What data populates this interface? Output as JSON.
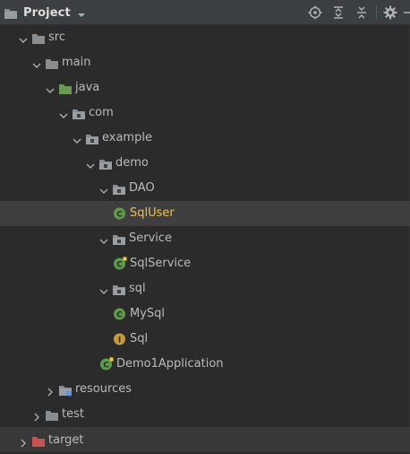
{
  "header": {
    "title": "Project",
    "toolbar": [
      {
        "name": "locate-icon"
      },
      {
        "name": "expand-all-icon"
      },
      {
        "name": "collapse-all-icon"
      },
      {
        "name": "gear-icon"
      }
    ]
  },
  "colors": {
    "folder": "#8a8d90",
    "source_folder": "#6a9955",
    "resources_folder": "#8a8d90",
    "excluded_folder": "#c75450",
    "class_icon": "#5f9a4c",
    "interface_icon": "#c49a40",
    "selected_text": "#e9c05a",
    "text": "#bbbbbb"
  },
  "tree": [
    {
      "label": "src",
      "depth": 0,
      "expanded": true,
      "icon": "folder-icon"
    },
    {
      "label": "main",
      "depth": 1,
      "expanded": true,
      "icon": "folder-icon"
    },
    {
      "label": "java",
      "depth": 2,
      "expanded": true,
      "icon": "source-folder-icon"
    },
    {
      "label": "com",
      "depth": 3,
      "expanded": true,
      "icon": "package-icon"
    },
    {
      "label": "example",
      "depth": 4,
      "expanded": true,
      "icon": "package-icon"
    },
    {
      "label": "demo",
      "depth": 5,
      "expanded": true,
      "icon": "package-icon"
    },
    {
      "label": "DAO",
      "depth": 6,
      "expanded": true,
      "icon": "package-icon"
    },
    {
      "label": "SqlUser",
      "depth": 7,
      "icon": "class-icon",
      "badge": "C",
      "selected": true
    },
    {
      "label": "Service",
      "depth": 6,
      "expanded": true,
      "icon": "package-icon"
    },
    {
      "label": "SqlService",
      "depth": 7,
      "icon": "spring-class-icon",
      "badge": "C"
    },
    {
      "label": "sql",
      "depth": 6,
      "expanded": true,
      "icon": "package-icon"
    },
    {
      "label": "MySql",
      "depth": 7,
      "icon": "class-icon",
      "badge": "C"
    },
    {
      "label": "Sql",
      "depth": 7,
      "icon": "interface-icon",
      "badge": "I"
    },
    {
      "label": "Demo1Application",
      "depth": 6,
      "icon": "spring-class-icon",
      "badge": "C"
    },
    {
      "label": "resources",
      "depth": 2,
      "expanded": false,
      "icon": "resources-folder-icon"
    },
    {
      "label": "test",
      "depth": 1,
      "expanded": false,
      "icon": "folder-icon"
    },
    {
      "label": "target",
      "depth": 0,
      "expanded": false,
      "icon": "excluded-folder-icon"
    }
  ]
}
